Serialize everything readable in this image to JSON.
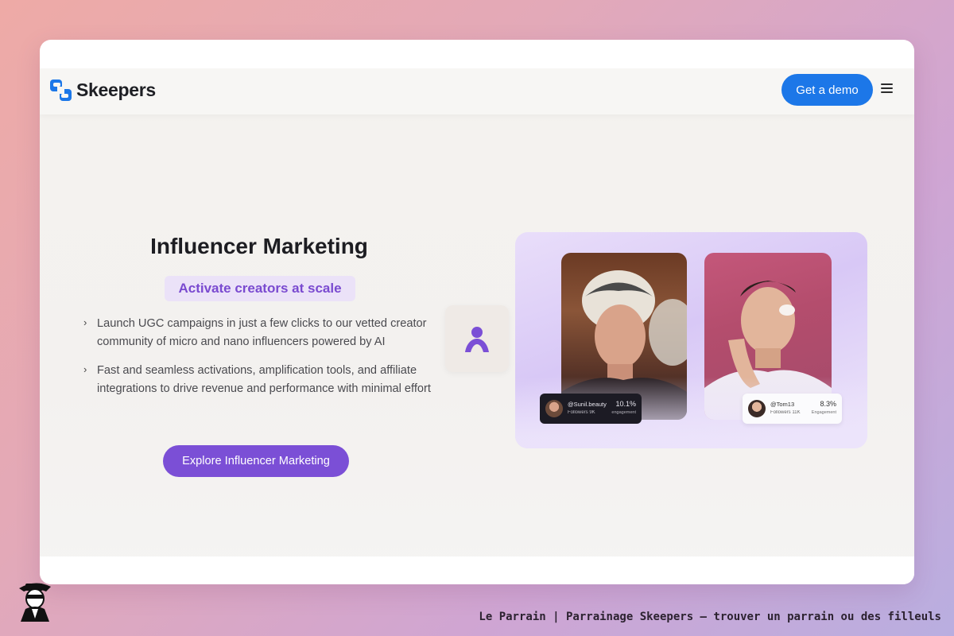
{
  "brand": {
    "name": "Skeepers",
    "accent": "#1c77e8",
    "purple": "#7b4fd6"
  },
  "nav": {
    "demo_label": "Get a demo",
    "menu_icon": "hamburger-menu-icon"
  },
  "hero": {
    "title": "Influencer Marketing",
    "tagline": "Activate creators at scale",
    "bullets": [
      "Launch UGC campaigns in just a few clicks to our vetted creator community of micro and nano influencers powered by AI",
      "Fast and seamless activations, amplification tools, and affiliate integrations to drive revenue and performance with minimal effort"
    ],
    "cta_label": "Explore Influencer Marketing"
  },
  "creators": [
    {
      "handle": "@Sunil.beauty",
      "followers": "Followers 9K",
      "rate": "10.1%",
      "rate_label": "engagement"
    },
    {
      "handle": "@Tom13",
      "followers": "Followers 11K",
      "rate": "8.3%",
      "rate_label": "Engagement"
    }
  ],
  "caption": "Le Parrain | Parrainage Skeepers — trouver un parrain ou des filleuls"
}
